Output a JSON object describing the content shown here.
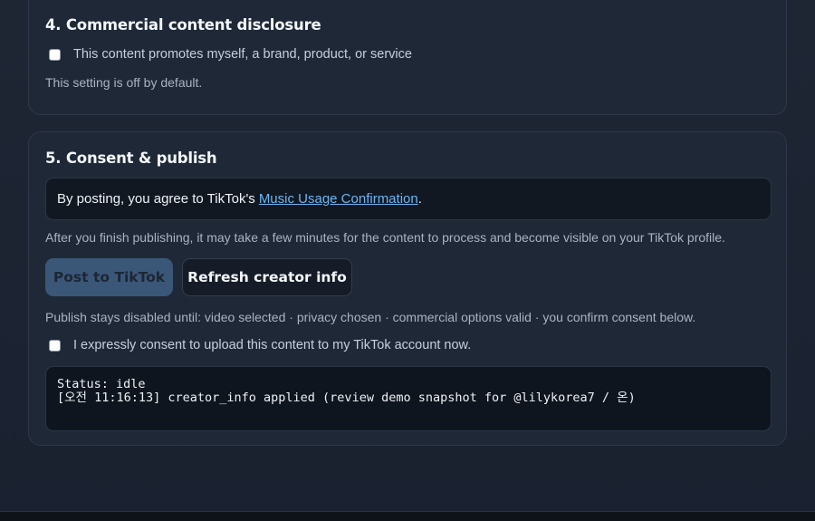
{
  "commercial": {
    "title": "4. Commercial content disclosure",
    "checkbox_label": "This content promotes myself, a brand, product, or service",
    "note": "This setting is off by default."
  },
  "consent": {
    "title": "5. Consent & publish",
    "agree_prefix": "By posting, you agree to TikTok's",
    "agree_link": "Music Usage Confirmation",
    "agree_suffix": ".",
    "publish_note": "After you finish publishing, it may take a few minutes for the content to process and become visible on your TikTok profile.",
    "post_button": "Post to TikTok",
    "refresh_button": "Refresh creator info",
    "disabled_note": "Publish stays disabled until: video selected · privacy chosen · commercial options valid · you confirm consent below.",
    "consent_checkbox_label": "I expressly consent to upload this content to my TikTok account now.",
    "status_line_1": "Status: idle",
    "status_line_2": "[오전 11:16:13] creator_info applied (review demo snapshot for @lilykorea7 / 온)"
  },
  "colors": {
    "background": "#1b2230",
    "card": "#1f2836",
    "link": "#6cb6f6",
    "post_button": "#3b5778"
  }
}
